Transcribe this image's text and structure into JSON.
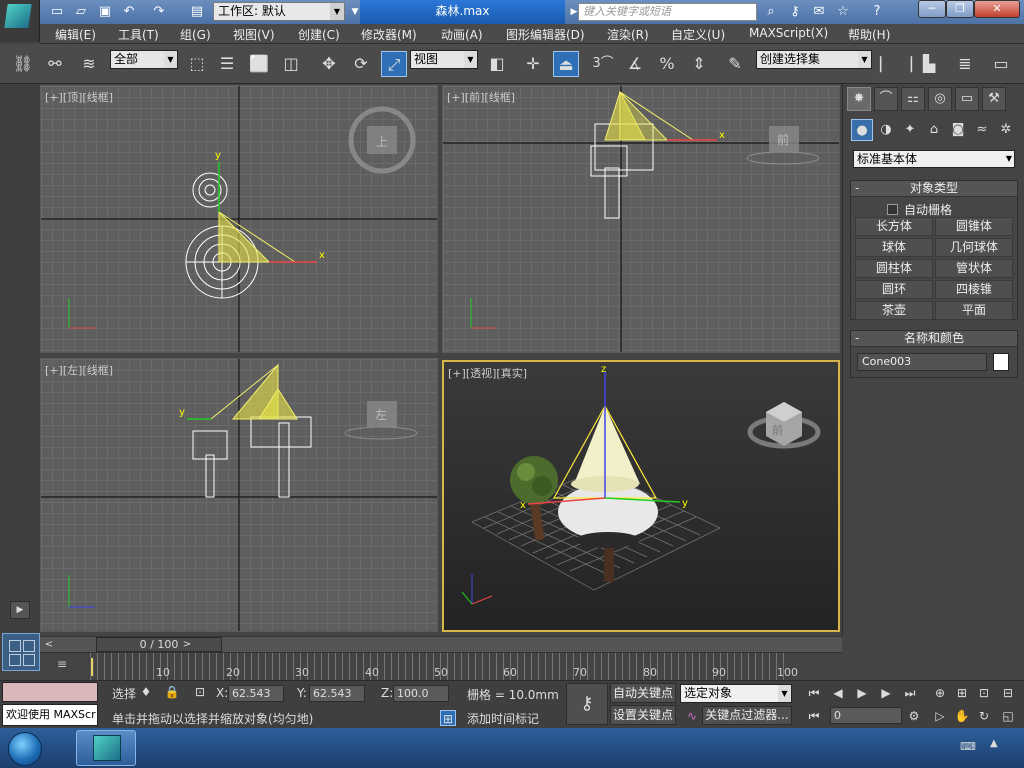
{
  "app": {
    "window_title": "森林.max",
    "workspace_label": "工作区: 默认",
    "search_placeholder": "键入关键字或短语"
  },
  "menus": [
    "编辑(E)",
    "工具(T)",
    "组(G)",
    "视图(V)",
    "创建(C)",
    "修改器(M)",
    "动画(A)",
    "图形编辑器(D)",
    "渲染(R)",
    "自定义(U)",
    "MAXScript(X)",
    "帮助(H)"
  ],
  "toolbar": {
    "selection_filter": "全部",
    "reference_coord": "视图",
    "named_selection": "创建选择集",
    "snap_label": "3"
  },
  "viewports": {
    "top": {
      "label_plus": "[+]",
      "label_view": "[顶]",
      "label_mode": "[线框]",
      "cube_label": "上"
    },
    "front": {
      "label_plus": "[+]",
      "label_view": "[前]",
      "label_mode": "[线框]",
      "cube_label": "前"
    },
    "left": {
      "label_plus": "[+]",
      "label_view": "[左]",
      "label_mode": "[线框]",
      "cube_label": "左"
    },
    "perspective": {
      "label_plus": "[+]",
      "label_view": "[透视]",
      "label_mode": "[真实]",
      "cube_label": "前"
    }
  },
  "axis_labels": {
    "x": "x",
    "y": "y",
    "z": "z"
  },
  "command_panel": {
    "category": "标准基本体",
    "object_type_title": "对象类型",
    "autogrid_label": "自动栅格",
    "objects": [
      "长方体",
      "圆锥体",
      "球体",
      "几何球体",
      "圆柱体",
      "管状体",
      "圆环",
      "四棱锥",
      "茶壶",
      "平面"
    ],
    "name_color_title": "名称和颜色",
    "object_name": "Cone003"
  },
  "timeline": {
    "slider_label": "0 / 100",
    "ticks": [
      "10",
      "20",
      "30",
      "40",
      "50",
      "60",
      "70",
      "80",
      "90",
      "100"
    ]
  },
  "status": {
    "welcome": "欢迎使用 MAXScr",
    "select_label": "选择",
    "x_label": "X:",
    "x_value": "62.543",
    "y_label": "Y:",
    "y_value": "62.543",
    "z_label": "Z:",
    "z_value": "100.0",
    "grid": "栅格 = 10.0mm",
    "prompt": "单击并拖动以选择并缩放对象(均匀地)",
    "add_time_tag": "添加时间标记",
    "auto_key": "自动关键点",
    "set_key": "设置关键点",
    "key_mode": "选定对象",
    "key_filters": "关键点过滤器...",
    "frame_value": "0"
  }
}
